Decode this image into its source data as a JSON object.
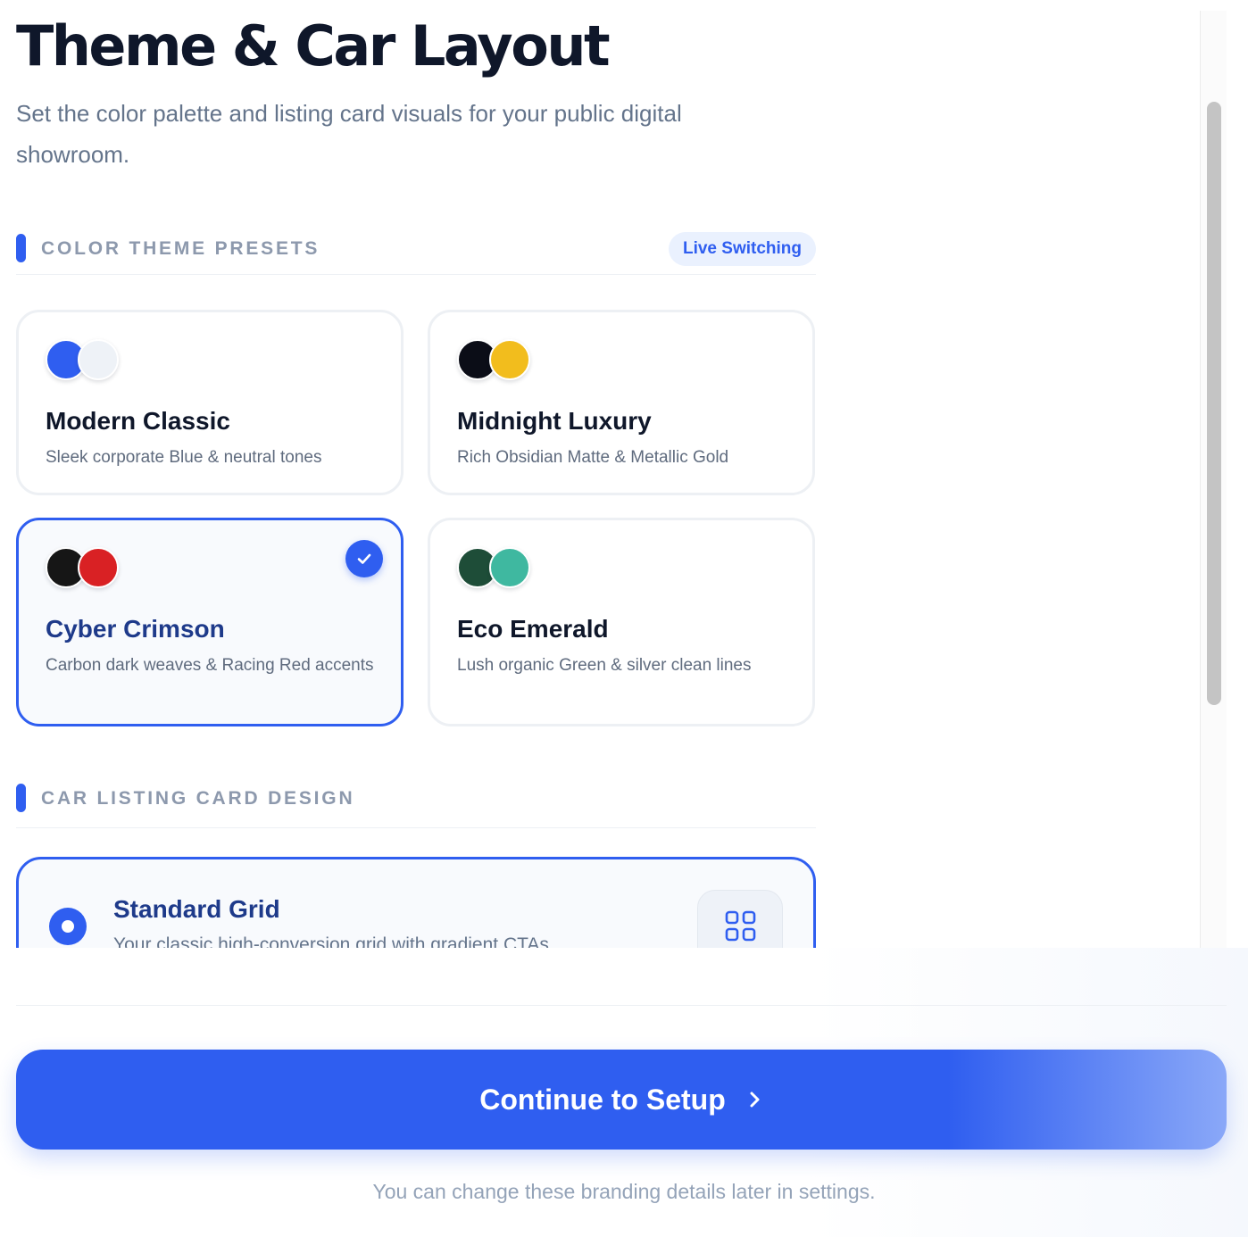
{
  "header": {
    "title": "Theme & Car Layout",
    "subtitle": "Set the color palette and listing card visuals for your public digital showroom."
  },
  "color_section": {
    "label": "COLOR THEME PRESETS",
    "badge": "Live Switching",
    "themes": [
      {
        "name": "Modern Classic",
        "description": "Sleek corporate Blue & neutral tones",
        "colors": [
          "#2f5ef0",
          "#eef2f7"
        ],
        "selected": false
      },
      {
        "name": "Midnight Luxury",
        "description": "Rich Obsidian Matte & Metallic Gold",
        "colors": [
          "#0b0d17",
          "#f2bd1d"
        ],
        "selected": false
      },
      {
        "name": "Cyber Crimson",
        "description": "Carbon dark weaves & Racing Red accents",
        "colors": [
          "#161616",
          "#d92124"
        ],
        "selected": true
      },
      {
        "name": "Eco Emerald",
        "description": "Lush organic Green & silver clean lines",
        "colors": [
          "#1e4d38",
          "#3fb8a0"
        ],
        "selected": false
      }
    ]
  },
  "layout_section": {
    "label": "CAR LISTING CARD DESIGN",
    "options": [
      {
        "name": "Standard Grid",
        "description": "Your classic high-conversion grid with gradient CTAs",
        "selected": true,
        "icon": "grid-icon"
      }
    ]
  },
  "footer": {
    "button_label": "Continue to Setup",
    "button_icon": "chevron-right-icon",
    "note": "You can change these branding details later in settings."
  },
  "colors": {
    "accent": "#2f5ef0",
    "heading": "#0f172a",
    "selected_heading": "#1e3a8a",
    "muted": "#64748b"
  }
}
